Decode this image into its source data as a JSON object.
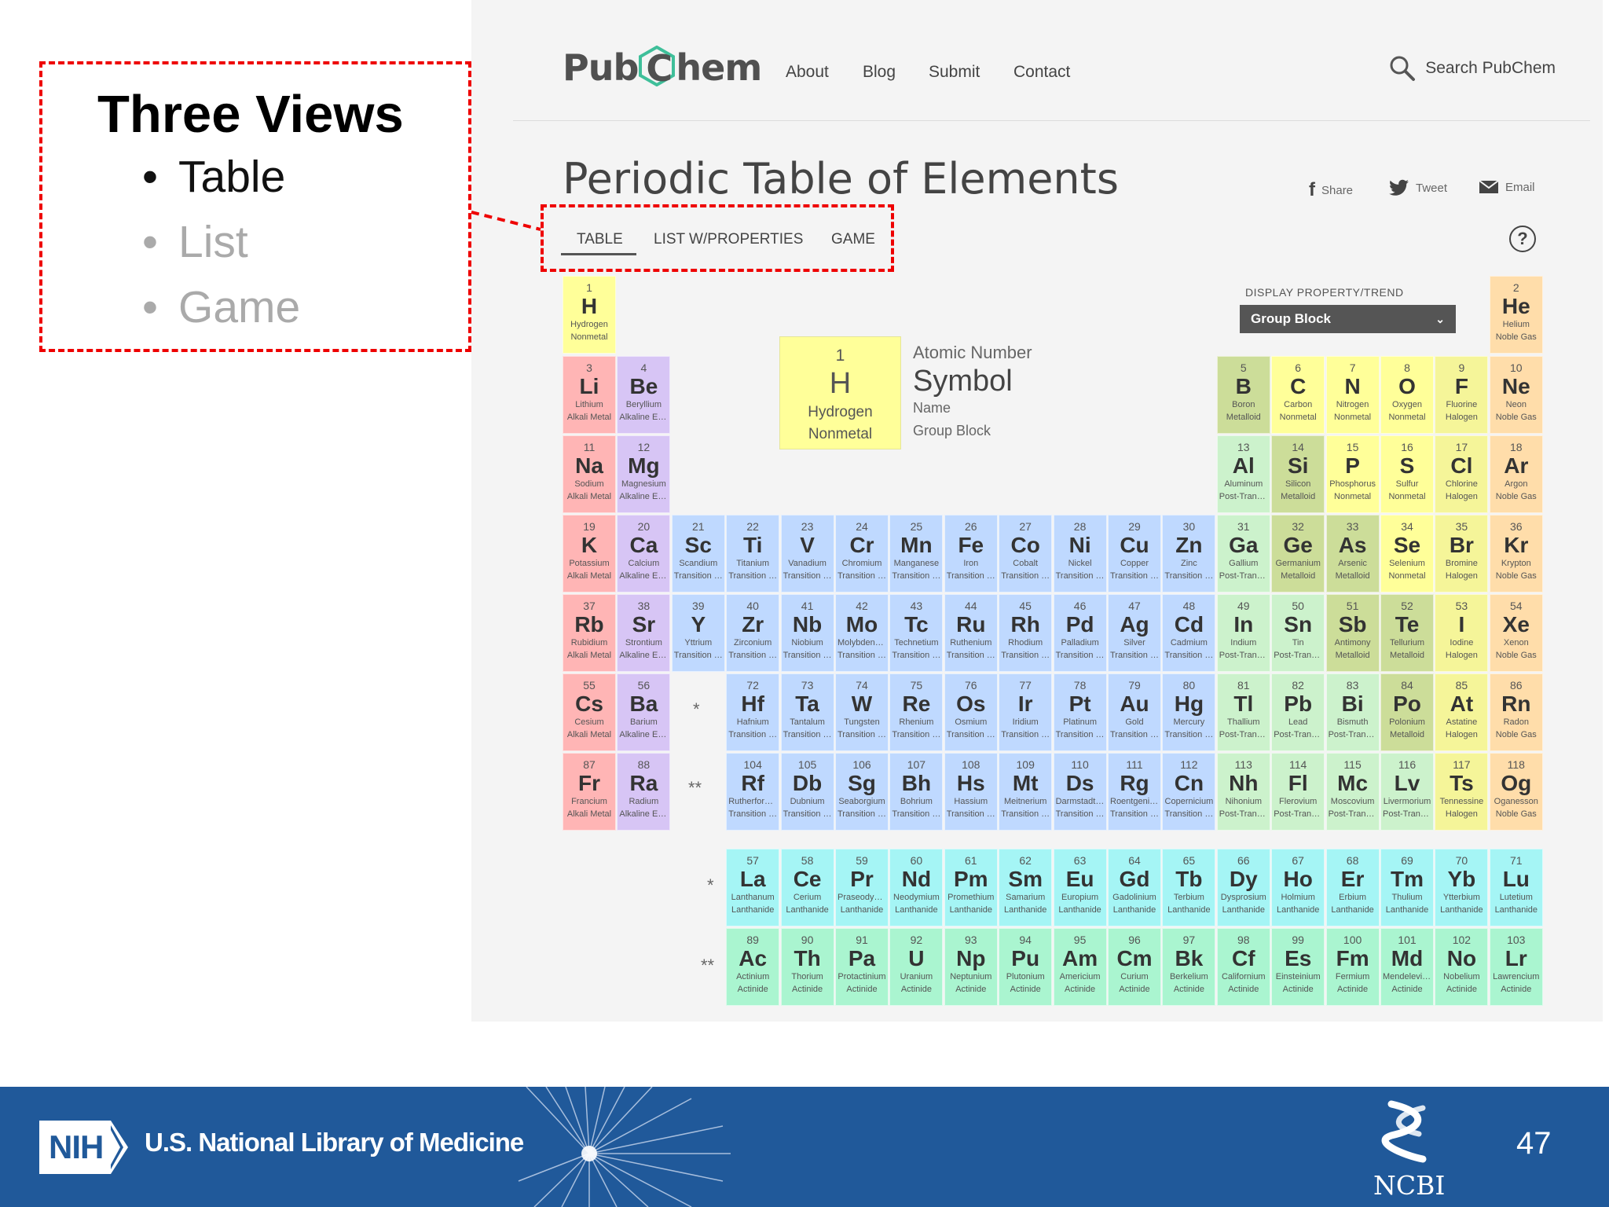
{
  "slide": {
    "title": "Three Views",
    "bullets": [
      {
        "text": "Table",
        "active": true
      },
      {
        "text": "List",
        "active": false
      },
      {
        "text": "Game",
        "active": false
      }
    ],
    "page_number": "47"
  },
  "pubchem": {
    "logo_left": "Pub",
    "logo_c": "C",
    "logo_right": "hem",
    "nav": [
      "About",
      "Blog",
      "Submit",
      "Contact"
    ],
    "search_label": "Search PubChem",
    "page_title": "Periodic Table of Elements",
    "share": [
      "Share",
      "Tweet",
      "Email"
    ],
    "tabs": [
      "TABLE",
      "LIST W/PROPERTIES",
      "GAME"
    ],
    "active_tab": "TABLE",
    "help_icon": "?",
    "display_label": "DISPLAY PROPERTY/TREND",
    "display_value": "Group Block",
    "legend": {
      "number": "1",
      "symbol": "H",
      "name": "Hydrogen",
      "group": "Nonmetal",
      "labels": [
        "Atomic Number",
        "Symbol",
        "Name",
        "Group Block"
      ]
    },
    "lanthanide_marker": "*",
    "actinide_marker": "**"
  },
  "footer": {
    "nih_badge": "NIH",
    "nlm_text": "U.S. National Library of Medicine",
    "ncbi_text": "NCBI"
  },
  "colors": {
    "Alkali Metal": "#ffb5b5",
    "Alkaline Earth Metal": "#d7c5f5",
    "Transition Metal": "#bfd9ff",
    "Post-Transition Metal": "#ccf2cc",
    "Metalloid": "#ccdd99",
    "Nonmetal": "#ffff99",
    "Halogen": "#f5f599",
    "Noble Gas": "#ffddaa",
    "Lanthanide": "#a5f5f5",
    "Actinide": "#aaf5d0",
    "callout_red": "#e00000",
    "footer_blue": "#20599a"
  },
  "elements": [
    {
      "n": "1",
      "s": "H",
      "name": "Hydrogen",
      "g": "Nonmetal",
      "r": 1,
      "c": 1
    },
    {
      "n": "2",
      "s": "He",
      "name": "Helium",
      "g": "Noble Gas",
      "r": 1,
      "c": 18
    },
    {
      "n": "3",
      "s": "Li",
      "name": "Lithium",
      "g": "Alkali Metal",
      "r": 2,
      "c": 1
    },
    {
      "n": "4",
      "s": "Be",
      "name": "Beryllium",
      "g": "Alkaline Earth Metal",
      "r": 2,
      "c": 2
    },
    {
      "n": "5",
      "s": "B",
      "name": "Boron",
      "g": "Metalloid",
      "r": 2,
      "c": 13
    },
    {
      "n": "6",
      "s": "C",
      "name": "Carbon",
      "g": "Nonmetal",
      "r": 2,
      "c": 14
    },
    {
      "n": "7",
      "s": "N",
      "name": "Nitrogen",
      "g": "Nonmetal",
      "r": 2,
      "c": 15
    },
    {
      "n": "8",
      "s": "O",
      "name": "Oxygen",
      "g": "Nonmetal",
      "r": 2,
      "c": 16
    },
    {
      "n": "9",
      "s": "F",
      "name": "Fluorine",
      "g": "Halogen",
      "r": 2,
      "c": 17
    },
    {
      "n": "10",
      "s": "Ne",
      "name": "Neon",
      "g": "Noble Gas",
      "r": 2,
      "c": 18
    },
    {
      "n": "11",
      "s": "Na",
      "name": "Sodium",
      "g": "Alkali Metal",
      "r": 3,
      "c": 1
    },
    {
      "n": "12",
      "s": "Mg",
      "name": "Magnesium",
      "g": "Alkaline Earth Metal",
      "r": 3,
      "c": 2
    },
    {
      "n": "13",
      "s": "Al",
      "name": "Aluminum",
      "g": "Post-Transition Metal",
      "r": 3,
      "c": 13
    },
    {
      "n": "14",
      "s": "Si",
      "name": "Silicon",
      "g": "Metalloid",
      "r": 3,
      "c": 14
    },
    {
      "n": "15",
      "s": "P",
      "name": "Phosphorus",
      "g": "Nonmetal",
      "r": 3,
      "c": 15
    },
    {
      "n": "16",
      "s": "S",
      "name": "Sulfur",
      "g": "Nonmetal",
      "r": 3,
      "c": 16
    },
    {
      "n": "17",
      "s": "Cl",
      "name": "Chlorine",
      "g": "Halogen",
      "r": 3,
      "c": 17
    },
    {
      "n": "18",
      "s": "Ar",
      "name": "Argon",
      "g": "Noble Gas",
      "r": 3,
      "c": 18
    },
    {
      "n": "19",
      "s": "K",
      "name": "Potassium",
      "g": "Alkali Metal",
      "r": 4,
      "c": 1
    },
    {
      "n": "20",
      "s": "Ca",
      "name": "Calcium",
      "g": "Alkaline Earth Metal",
      "r": 4,
      "c": 2
    },
    {
      "n": "21",
      "s": "Sc",
      "name": "Scandium",
      "g": "Transition Metal",
      "r": 4,
      "c": 3
    },
    {
      "n": "22",
      "s": "Ti",
      "name": "Titanium",
      "g": "Transition Metal",
      "r": 4,
      "c": 4
    },
    {
      "n": "23",
      "s": "V",
      "name": "Vanadium",
      "g": "Transition Metal",
      "r": 4,
      "c": 5
    },
    {
      "n": "24",
      "s": "Cr",
      "name": "Chromium",
      "g": "Transition Metal",
      "r": 4,
      "c": 6
    },
    {
      "n": "25",
      "s": "Mn",
      "name": "Manganese",
      "g": "Transition Metal",
      "r": 4,
      "c": 7
    },
    {
      "n": "26",
      "s": "Fe",
      "name": "Iron",
      "g": "Transition Metal",
      "r": 4,
      "c": 8
    },
    {
      "n": "27",
      "s": "Co",
      "name": "Cobalt",
      "g": "Transition Metal",
      "r": 4,
      "c": 9
    },
    {
      "n": "28",
      "s": "Ni",
      "name": "Nickel",
      "g": "Transition Metal",
      "r": 4,
      "c": 10
    },
    {
      "n": "29",
      "s": "Cu",
      "name": "Copper",
      "g": "Transition Metal",
      "r": 4,
      "c": 11
    },
    {
      "n": "30",
      "s": "Zn",
      "name": "Zinc",
      "g": "Transition Metal",
      "r": 4,
      "c": 12
    },
    {
      "n": "31",
      "s": "Ga",
      "name": "Gallium",
      "g": "Post-Transition Metal",
      "r": 4,
      "c": 13
    },
    {
      "n": "32",
      "s": "Ge",
      "name": "Germanium",
      "g": "Metalloid",
      "r": 4,
      "c": 14
    },
    {
      "n": "33",
      "s": "As",
      "name": "Arsenic",
      "g": "Metalloid",
      "r": 4,
      "c": 15
    },
    {
      "n": "34",
      "s": "Se",
      "name": "Selenium",
      "g": "Nonmetal",
      "r": 4,
      "c": 16
    },
    {
      "n": "35",
      "s": "Br",
      "name": "Bromine",
      "g": "Halogen",
      "r": 4,
      "c": 17
    },
    {
      "n": "36",
      "s": "Kr",
      "name": "Krypton",
      "g": "Noble Gas",
      "r": 4,
      "c": 18
    },
    {
      "n": "37",
      "s": "Rb",
      "name": "Rubidium",
      "g": "Alkali Metal",
      "r": 5,
      "c": 1
    },
    {
      "n": "38",
      "s": "Sr",
      "name": "Strontium",
      "g": "Alkaline Earth Metal",
      "r": 5,
      "c": 2
    },
    {
      "n": "39",
      "s": "Y",
      "name": "Yttrium",
      "g": "Transition Metal",
      "r": 5,
      "c": 3
    },
    {
      "n": "40",
      "s": "Zr",
      "name": "Zirconium",
      "g": "Transition Metal",
      "r": 5,
      "c": 4
    },
    {
      "n": "41",
      "s": "Nb",
      "name": "Niobium",
      "g": "Transition Metal",
      "r": 5,
      "c": 5
    },
    {
      "n": "42",
      "s": "Mo",
      "name": "Molybdenum",
      "g": "Transition Metal",
      "r": 5,
      "c": 6
    },
    {
      "n": "43",
      "s": "Tc",
      "name": "Technetium",
      "g": "Transition Metal",
      "r": 5,
      "c": 7
    },
    {
      "n": "44",
      "s": "Ru",
      "name": "Ruthenium",
      "g": "Transition Metal",
      "r": 5,
      "c": 8
    },
    {
      "n": "45",
      "s": "Rh",
      "name": "Rhodium",
      "g": "Transition Metal",
      "r": 5,
      "c": 9
    },
    {
      "n": "46",
      "s": "Pd",
      "name": "Palladium",
      "g": "Transition Metal",
      "r": 5,
      "c": 10
    },
    {
      "n": "47",
      "s": "Ag",
      "name": "Silver",
      "g": "Transition Metal",
      "r": 5,
      "c": 11
    },
    {
      "n": "48",
      "s": "Cd",
      "name": "Cadmium",
      "g": "Transition Metal",
      "r": 5,
      "c": 12
    },
    {
      "n": "49",
      "s": "In",
      "name": "Indium",
      "g": "Post-Transition Metal",
      "r": 5,
      "c": 13
    },
    {
      "n": "50",
      "s": "Sn",
      "name": "Tin",
      "g": "Post-Transition Metal",
      "r": 5,
      "c": 14
    },
    {
      "n": "51",
      "s": "Sb",
      "name": "Antimony",
      "g": "Metalloid",
      "r": 5,
      "c": 15
    },
    {
      "n": "52",
      "s": "Te",
      "name": "Tellurium",
      "g": "Metalloid",
      "r": 5,
      "c": 16
    },
    {
      "n": "53",
      "s": "I",
      "name": "Iodine",
      "g": "Halogen",
      "r": 5,
      "c": 17
    },
    {
      "n": "54",
      "s": "Xe",
      "name": "Xenon",
      "g": "Noble Gas",
      "r": 5,
      "c": 18
    },
    {
      "n": "55",
      "s": "Cs",
      "name": "Cesium",
      "g": "Alkali Metal",
      "r": 6,
      "c": 1
    },
    {
      "n": "56",
      "s": "Ba",
      "name": "Barium",
      "g": "Alkaline Earth Metal",
      "r": 6,
      "c": 2
    },
    {
      "n": "72",
      "s": "Hf",
      "name": "Hafnium",
      "g": "Transition Metal",
      "r": 6,
      "c": 4
    },
    {
      "n": "73",
      "s": "Ta",
      "name": "Tantalum",
      "g": "Transition Metal",
      "r": 6,
      "c": 5
    },
    {
      "n": "74",
      "s": "W",
      "name": "Tungsten",
      "g": "Transition Metal",
      "r": 6,
      "c": 6
    },
    {
      "n": "75",
      "s": "Re",
      "name": "Rhenium",
      "g": "Transition Metal",
      "r": 6,
      "c": 7
    },
    {
      "n": "76",
      "s": "Os",
      "name": "Osmium",
      "g": "Transition Metal",
      "r": 6,
      "c": 8
    },
    {
      "n": "77",
      "s": "Ir",
      "name": "Iridium",
      "g": "Transition Metal",
      "r": 6,
      "c": 9
    },
    {
      "n": "78",
      "s": "Pt",
      "name": "Platinum",
      "g": "Transition Metal",
      "r": 6,
      "c": 10
    },
    {
      "n": "79",
      "s": "Au",
      "name": "Gold",
      "g": "Transition Metal",
      "r": 6,
      "c": 11
    },
    {
      "n": "80",
      "s": "Hg",
      "name": "Mercury",
      "g": "Transition Metal",
      "r": 6,
      "c": 12
    },
    {
      "n": "81",
      "s": "Tl",
      "name": "Thallium",
      "g": "Post-Transition Metal",
      "r": 6,
      "c": 13
    },
    {
      "n": "82",
      "s": "Pb",
      "name": "Lead",
      "g": "Post-Transition Metal",
      "r": 6,
      "c": 14
    },
    {
      "n": "83",
      "s": "Bi",
      "name": "Bismuth",
      "g": "Post-Transition Metal",
      "r": 6,
      "c": 15
    },
    {
      "n": "84",
      "s": "Po",
      "name": "Polonium",
      "g": "Metalloid",
      "r": 6,
      "c": 16
    },
    {
      "n": "85",
      "s": "At",
      "name": "Astatine",
      "g": "Halogen",
      "r": 6,
      "c": 17
    },
    {
      "n": "86",
      "s": "Rn",
      "name": "Radon",
      "g": "Noble Gas",
      "r": 6,
      "c": 18
    },
    {
      "n": "87",
      "s": "Fr",
      "name": "Francium",
      "g": "Alkali Metal",
      "r": 7,
      "c": 1
    },
    {
      "n": "88",
      "s": "Ra",
      "name": "Radium",
      "g": "Alkaline Earth Metal",
      "r": 7,
      "c": 2
    },
    {
      "n": "104",
      "s": "Rf",
      "name": "Rutherfordium",
      "g": "Transition Metal",
      "r": 7,
      "c": 4
    },
    {
      "n": "105",
      "s": "Db",
      "name": "Dubnium",
      "g": "Transition Metal",
      "r": 7,
      "c": 5
    },
    {
      "n": "106",
      "s": "Sg",
      "name": "Seaborgium",
      "g": "Transition Metal",
      "r": 7,
      "c": 6
    },
    {
      "n": "107",
      "s": "Bh",
      "name": "Bohrium",
      "g": "Transition Metal",
      "r": 7,
      "c": 7
    },
    {
      "n": "108",
      "s": "Hs",
      "name": "Hassium",
      "g": "Transition Metal",
      "r": 7,
      "c": 8
    },
    {
      "n": "109",
      "s": "Mt",
      "name": "Meitnerium",
      "g": "Transition Metal",
      "r": 7,
      "c": 9
    },
    {
      "n": "110",
      "s": "Ds",
      "name": "Darmstadtium",
      "g": "Transition Metal",
      "r": 7,
      "c": 10
    },
    {
      "n": "111",
      "s": "Rg",
      "name": "Roentgenium",
      "g": "Transition Metal",
      "r": 7,
      "c": 11
    },
    {
      "n": "112",
      "s": "Cn",
      "name": "Copernicium",
      "g": "Transition Metal",
      "r": 7,
      "c": 12
    },
    {
      "n": "113",
      "s": "Nh",
      "name": "Nihonium",
      "g": "Post-Transition Metal",
      "r": 7,
      "c": 13
    },
    {
      "n": "114",
      "s": "Fl",
      "name": "Flerovium",
      "g": "Post-Transition Metal",
      "r": 7,
      "c": 14
    },
    {
      "n": "115",
      "s": "Mc",
      "name": "Moscovium",
      "g": "Post-Transition Metal",
      "r": 7,
      "c": 15
    },
    {
      "n": "116",
      "s": "Lv",
      "name": "Livermorium",
      "g": "Post-Transition Metal",
      "r": 7,
      "c": 16
    },
    {
      "n": "117",
      "s": "Ts",
      "name": "Tennessine",
      "g": "Halogen",
      "r": 7,
      "c": 17
    },
    {
      "n": "118",
      "s": "Og",
      "name": "Oganesson",
      "g": "Noble Gas",
      "r": 7,
      "c": 18
    },
    {
      "n": "57",
      "s": "La",
      "name": "Lanthanum",
      "g": "Lanthanide",
      "r": 9,
      "c": 4
    },
    {
      "n": "58",
      "s": "Ce",
      "name": "Cerium",
      "g": "Lanthanide",
      "r": 9,
      "c": 5
    },
    {
      "n": "59",
      "s": "Pr",
      "name": "Praseodymium",
      "g": "Lanthanide",
      "r": 9,
      "c": 6
    },
    {
      "n": "60",
      "s": "Nd",
      "name": "Neodymium",
      "g": "Lanthanide",
      "r": 9,
      "c": 7
    },
    {
      "n": "61",
      "s": "Pm",
      "name": "Promethium",
      "g": "Lanthanide",
      "r": 9,
      "c": 8
    },
    {
      "n": "62",
      "s": "Sm",
      "name": "Samarium",
      "g": "Lanthanide",
      "r": 9,
      "c": 9
    },
    {
      "n": "63",
      "s": "Eu",
      "name": "Europium",
      "g": "Lanthanide",
      "r": 9,
      "c": 10
    },
    {
      "n": "64",
      "s": "Gd",
      "name": "Gadolinium",
      "g": "Lanthanide",
      "r": 9,
      "c": 11
    },
    {
      "n": "65",
      "s": "Tb",
      "name": "Terbium",
      "g": "Lanthanide",
      "r": 9,
      "c": 12
    },
    {
      "n": "66",
      "s": "Dy",
      "name": "Dysprosium",
      "g": "Lanthanide",
      "r": 9,
      "c": 13
    },
    {
      "n": "67",
      "s": "Ho",
      "name": "Holmium",
      "g": "Lanthanide",
      "r": 9,
      "c": 14
    },
    {
      "n": "68",
      "s": "Er",
      "name": "Erbium",
      "g": "Lanthanide",
      "r": 9,
      "c": 15
    },
    {
      "n": "69",
      "s": "Tm",
      "name": "Thulium",
      "g": "Lanthanide",
      "r": 9,
      "c": 16
    },
    {
      "n": "70",
      "s": "Yb",
      "name": "Ytterbium",
      "g": "Lanthanide",
      "r": 9,
      "c": 17
    },
    {
      "n": "71",
      "s": "Lu",
      "name": "Lutetium",
      "g": "Lanthanide",
      "r": 9,
      "c": 18
    },
    {
      "n": "89",
      "s": "Ac",
      "name": "Actinium",
      "g": "Actinide",
      "r": 10,
      "c": 4
    },
    {
      "n": "90",
      "s": "Th",
      "name": "Thorium",
      "g": "Actinide",
      "r": 10,
      "c": 5
    },
    {
      "n": "91",
      "s": "Pa",
      "name": "Protactinium",
      "g": "Actinide",
      "r": 10,
      "c": 6
    },
    {
      "n": "92",
      "s": "U",
      "name": "Uranium",
      "g": "Actinide",
      "r": 10,
      "c": 7
    },
    {
      "n": "93",
      "s": "Np",
      "name": "Neptunium",
      "g": "Actinide",
      "r": 10,
      "c": 8
    },
    {
      "n": "94",
      "s": "Pu",
      "name": "Plutonium",
      "g": "Actinide",
      "r": 10,
      "c": 9
    },
    {
      "n": "95",
      "s": "Am",
      "name": "Americium",
      "g": "Actinide",
      "r": 10,
      "c": 10
    },
    {
      "n": "96",
      "s": "Cm",
      "name": "Curium",
      "g": "Actinide",
      "r": 10,
      "c": 11
    },
    {
      "n": "97",
      "s": "Bk",
      "name": "Berkelium",
      "g": "Actinide",
      "r": 10,
      "c": 12
    },
    {
      "n": "98",
      "s": "Cf",
      "name": "Californium",
      "g": "Actinide",
      "r": 10,
      "c": 13
    },
    {
      "n": "99",
      "s": "Es",
      "name": "Einsteinium",
      "g": "Actinide",
      "r": 10,
      "c": 14
    },
    {
      "n": "100",
      "s": "Fm",
      "name": "Fermium",
      "g": "Actinide",
      "r": 10,
      "c": 15
    },
    {
      "n": "101",
      "s": "Md",
      "name": "Mendelevium",
      "g": "Actinide",
      "r": 10,
      "c": 16
    },
    {
      "n": "102",
      "s": "No",
      "name": "Nobelium",
      "g": "Actinide",
      "r": 10,
      "c": 17
    },
    {
      "n": "103",
      "s": "Lr",
      "name": "Lawrencium",
      "g": "Actinide",
      "r": 10,
      "c": 18
    }
  ]
}
